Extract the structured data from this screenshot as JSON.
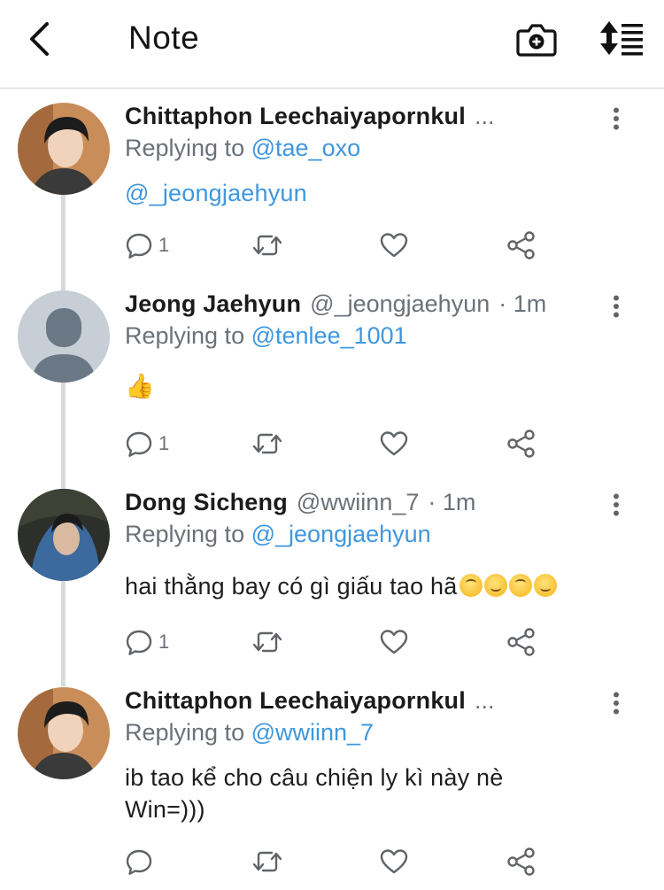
{
  "header": {
    "title": "Note",
    "back_icon": "chevron-left-icon",
    "camera_icon": "camera-add-icon",
    "sort_icon": "sort-list-icon"
  },
  "colors": {
    "mention": "#3f97de",
    "muted": "#6b7178",
    "thread_line": "#d7dbdf"
  },
  "tweets": [
    {
      "name": "Chittaphon Leechaiyapornkul",
      "handle": "",
      "truncation": "...",
      "time": "",
      "replying_prefix": "Replying to",
      "replying_to": "@tae_oxo",
      "body": "@_jeongjaehyun",
      "reply_count": "1"
    },
    {
      "name": "Jeong Jaehyun",
      "handle": "@_jeongjaehyun",
      "time": "· 1m",
      "replying_prefix": "Replying to",
      "replying_to": "@tenlee_1001",
      "body": "👍",
      "reply_count": "1"
    },
    {
      "name": "Dong Sicheng",
      "handle": "@wwiinn_7",
      "time": "· 1m",
      "replying_prefix": "Replying to",
      "replying_to": "@_jeongjaehyun",
      "body": "hai thằng bay có gì giấu tao hã",
      "reply_count": "1"
    },
    {
      "name": "Chittaphon Leechaiyapornkul",
      "handle": "",
      "truncation": "...",
      "time": "",
      "replying_prefix": "Replying to",
      "replying_to": "@wwiinn_7",
      "body_line1": "ib tao kể cho câu chiện ly kì này nè",
      "body_line2": "Win=)))",
      "reply_count": ""
    }
  ]
}
